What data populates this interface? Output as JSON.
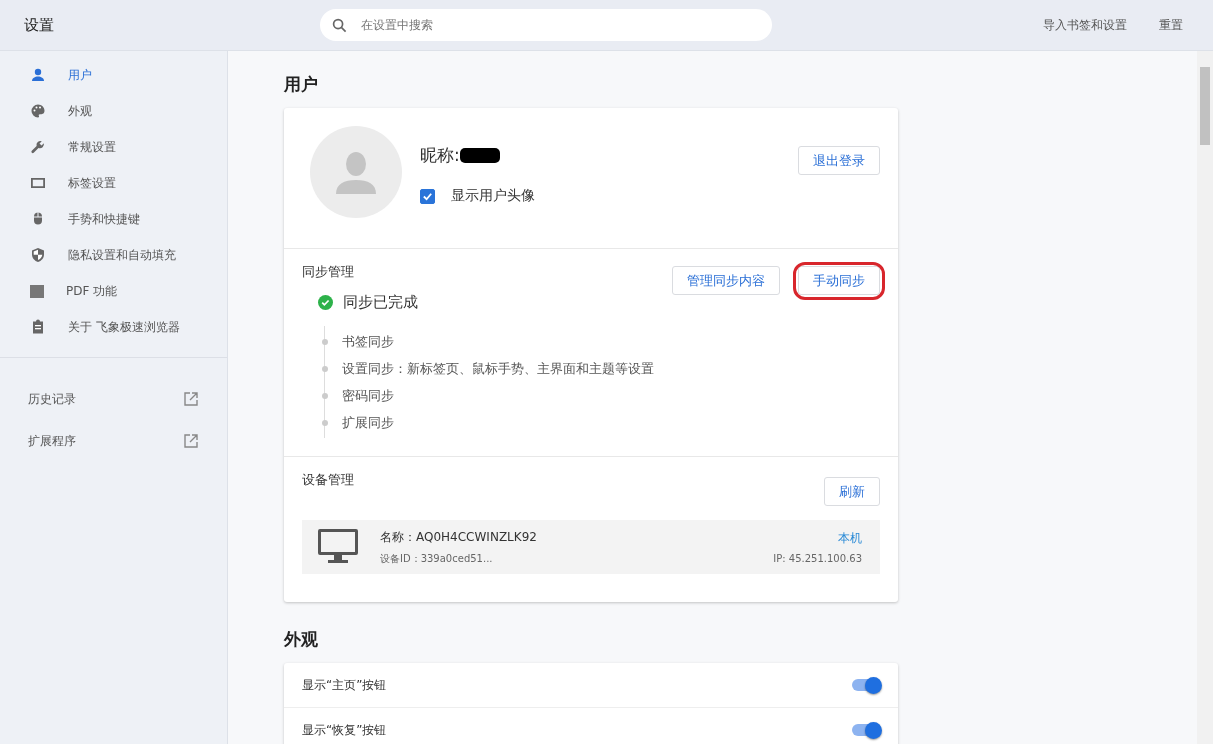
{
  "header": {
    "title": "设置",
    "search": {
      "placeholder": "在设置中搜索"
    },
    "actions": [
      "导入书签和设置",
      "重置"
    ]
  },
  "sidebar": {
    "items": [
      {
        "label": "用户",
        "selected": true
      },
      {
        "label": "外观",
        "selected": false
      },
      {
        "label": "常规设置",
        "selected": false
      },
      {
        "label": "标签设置",
        "selected": false
      },
      {
        "label": "手势和快捷键",
        "selected": false
      },
      {
        "label": "隐私设置和自动填充",
        "selected": false
      },
      {
        "label": "PDF 功能",
        "selected": false
      },
      {
        "label": "关于 飞象极速浏览器",
        "selected": false
      }
    ],
    "links": [
      "历史记录",
      "扩展程序"
    ]
  },
  "user_section": {
    "title": "用户",
    "nickname_label": "昵称:",
    "show_avatar": {
      "label": "显示用户头像",
      "checked": true
    },
    "logout_button": "退出登录",
    "sync": {
      "title": "同步管理",
      "manage_button": "管理同步内容",
      "manual_button": {
        "label": "手动同步",
        "highlighted": true
      },
      "status": "同步已完成",
      "items": [
        "书签同步",
        "设置同步：新标签页、鼠标手势、主界面和主题等设置",
        "密码同步",
        "扩展同步"
      ]
    },
    "devices": {
      "title": "设备管理",
      "refresh_button": "刷新",
      "list": [
        {
          "name": "名称：AQ0H4CCWINZLK92",
          "id": "设备ID：339a0ced51...",
          "tag": "本机",
          "ip": "IP: 45.251.100.63"
        }
      ]
    }
  },
  "appearance_section": {
    "title": "外观",
    "rows": [
      {
        "label": "显示“主页”按钮",
        "on": true
      },
      {
        "label": "显示“恢复”按钮",
        "on": true
      }
    ]
  }
}
